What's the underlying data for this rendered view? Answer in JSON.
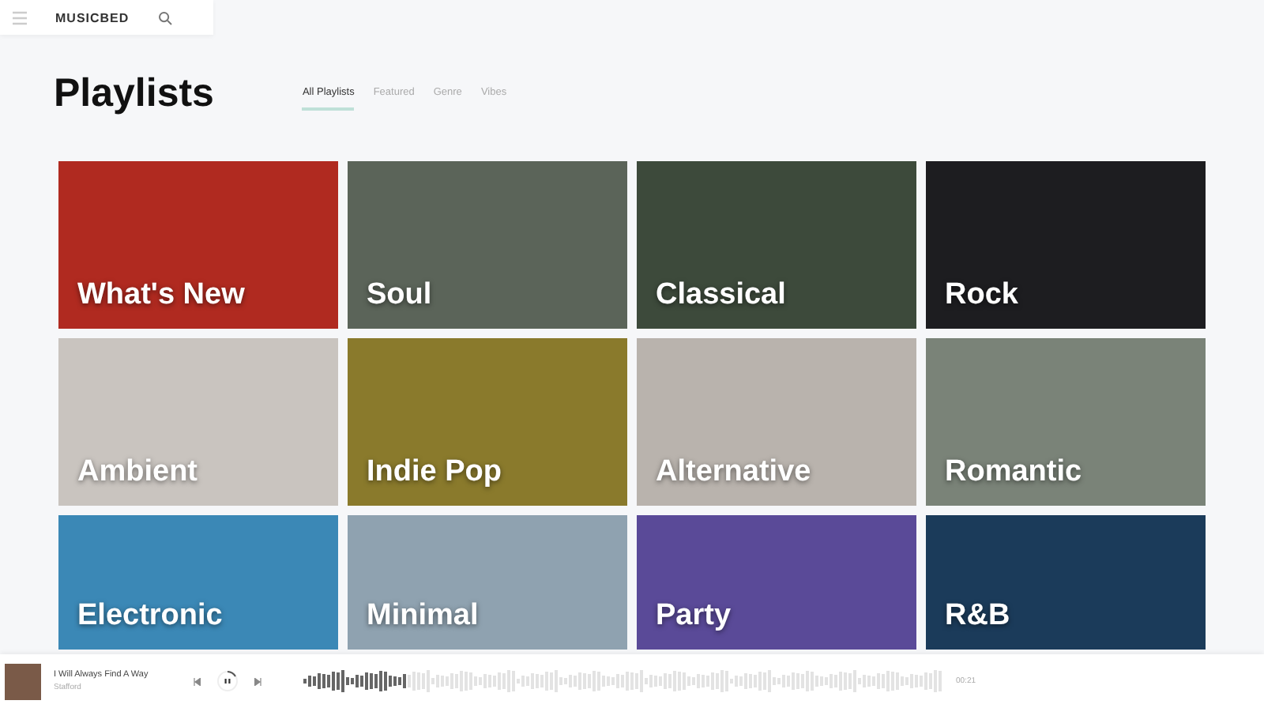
{
  "header": {
    "logo": "MUSICBED"
  },
  "page_title": "Playlists",
  "tabs": [
    {
      "label": "All Playlists",
      "selected": true
    },
    {
      "label": "Featured",
      "selected": false
    },
    {
      "label": "Genre",
      "selected": false
    },
    {
      "label": "Vibes",
      "selected": false
    }
  ],
  "playlists": [
    {
      "title": "What's New",
      "color": "#b02a20"
    },
    {
      "title": "Soul",
      "color": "#5b6459"
    },
    {
      "title": "Classical",
      "color": "#3d4a3b"
    },
    {
      "title": "Rock",
      "color": "#1d1d20"
    },
    {
      "title": "Ambient",
      "color": "#c9c4bf"
    },
    {
      "title": "Indie Pop",
      "color": "#8a7a2c"
    },
    {
      "title": "Alternative",
      "color": "#b9b3ad"
    },
    {
      "title": "Romantic",
      "color": "#7a8378"
    },
    {
      "title": "Electronic",
      "color": "#3b88b6"
    },
    {
      "title": "Minimal",
      "color": "#8fa2b0"
    },
    {
      "title": "Party",
      "color": "#5a4a98"
    },
    {
      "title": "R&B",
      "color": "#1b3b5a"
    }
  ],
  "player": {
    "song": "I Will Always Find A Way",
    "artist": "Stafford",
    "playing": true,
    "level": 0.16,
    "time": "00:21"
  }
}
